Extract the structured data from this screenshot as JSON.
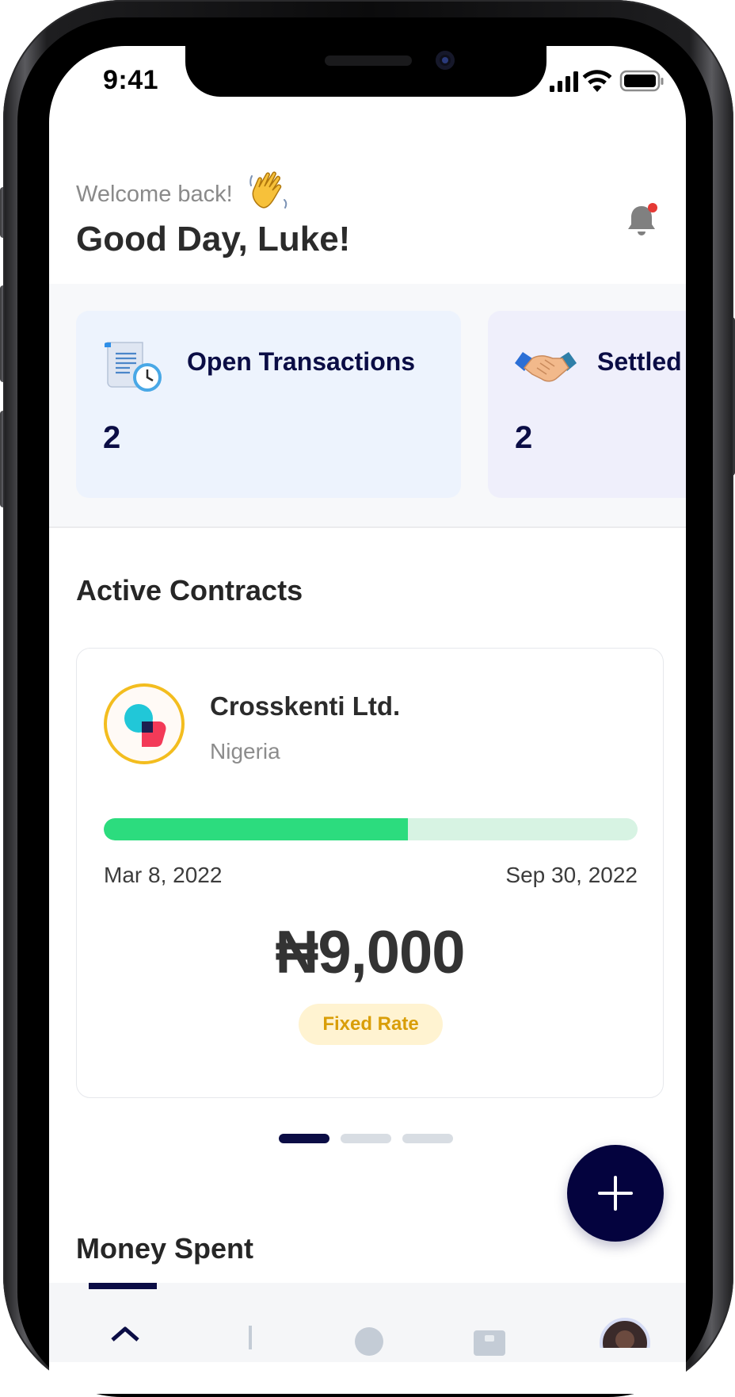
{
  "status_bar": {
    "time": "9:41"
  },
  "header": {
    "welcome": "Welcome back!",
    "greeting": "Good Day, Luke!"
  },
  "summary": [
    {
      "title": "Open Transactions",
      "count": "2",
      "icon": "document-clock-icon"
    },
    {
      "title": "Settled",
      "count": "2",
      "icon": "handshake-icon"
    }
  ],
  "active_contracts": {
    "title": "Active Contracts",
    "contract": {
      "company": "Crosskenti Ltd.",
      "country": "Nigeria",
      "start_date": "Mar 8, 2022",
      "end_date": "Sep 30, 2022",
      "progress_fraction": 0.57,
      "amount": "₦9,000",
      "rate_type": "Fixed Rate"
    },
    "pager": {
      "pages": 3,
      "active": 0
    }
  },
  "money_spent": {
    "title": "Money Spent"
  },
  "colors": {
    "brand_navy": "#0b0d45",
    "progress_green": "#2cdc7e",
    "badge_gold": "#d99e08",
    "notification_dot": "#e53935"
  },
  "icons": {
    "wave": "waving-hand-icon",
    "bell": "bell-icon",
    "fab": "plus-icon",
    "nav": [
      "home-icon",
      "chart-icon",
      "user-icon",
      "document-icon",
      "avatar"
    ]
  }
}
